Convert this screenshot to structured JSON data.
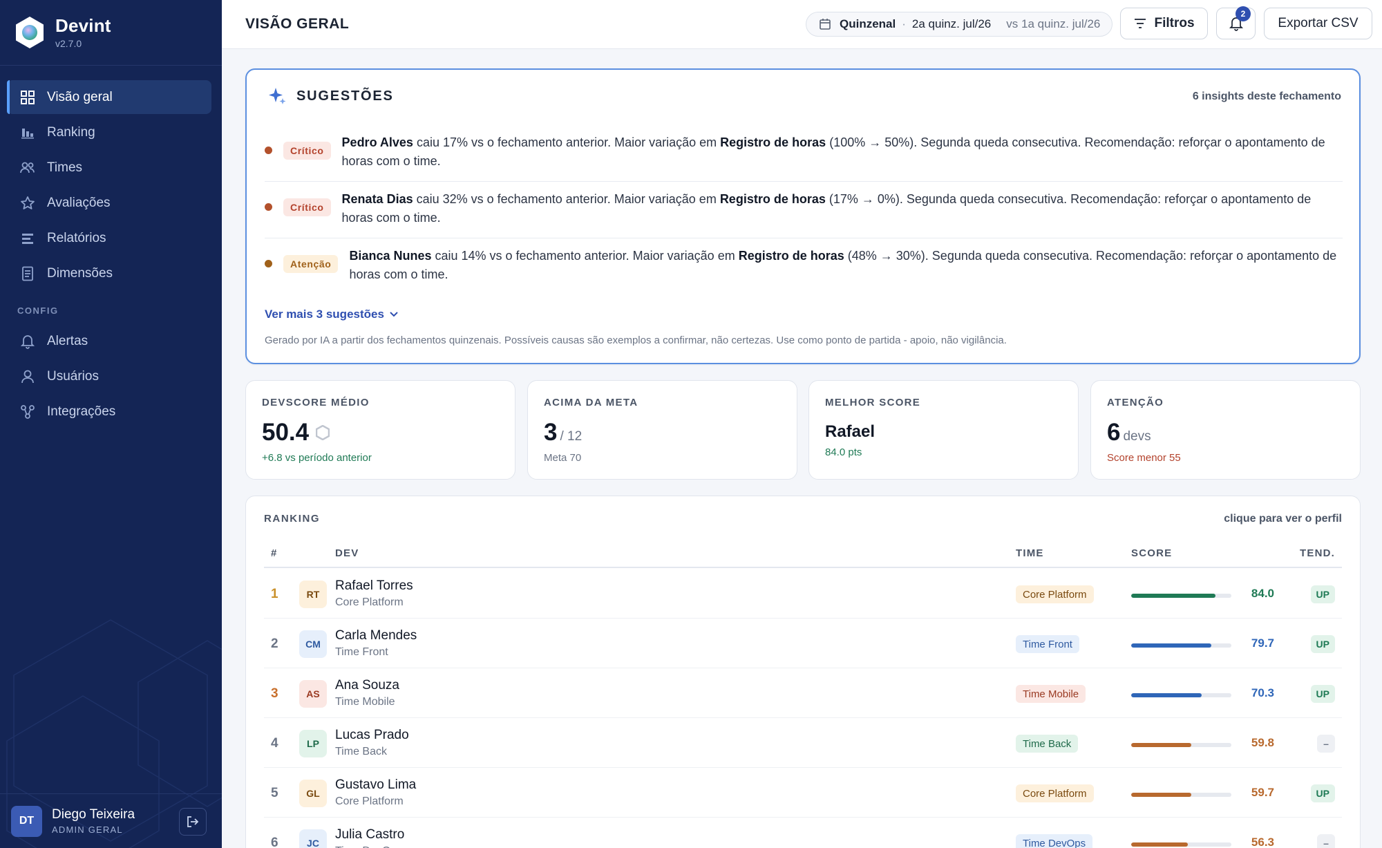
{
  "app": {
    "name": "Devint",
    "version": "v2.7.0"
  },
  "sidebar": {
    "items": [
      {
        "label": "Visão geral",
        "icon": "grid-icon",
        "active": true
      },
      {
        "label": "Ranking",
        "icon": "bar-chart-icon"
      },
      {
        "label": "Times",
        "icon": "users-icon"
      },
      {
        "label": "Avaliações",
        "icon": "star-icon"
      },
      {
        "label": "Relatórios",
        "icon": "list-icon"
      },
      {
        "label": "Dimensões",
        "icon": "document-icon"
      }
    ],
    "config_label": "CONFIG",
    "config_items": [
      {
        "label": "Alertas",
        "icon": "bell-icon"
      },
      {
        "label": "Usuários",
        "icon": "user-icon"
      },
      {
        "label": "Integrações",
        "icon": "integration-icon"
      }
    ]
  },
  "user": {
    "initials": "DT",
    "name": "Diego Teixeira",
    "role": "ADMIN GERAL"
  },
  "header": {
    "title": "VISÃO GERAL",
    "period": {
      "type": "Quinzenal",
      "current": "2a quinz. jul/26",
      "compare": "vs 1a quinz. jul/26"
    },
    "filters_label": "Filtros",
    "notifications_count": "2",
    "export_label": "Exportar CSV"
  },
  "suggestions": {
    "title": "SUGESTÕES",
    "count_label": "6 insights deste fechamento",
    "items": [
      {
        "severity": "Crítico",
        "severity_type": "critico",
        "color": "#b3512c",
        "name": "Pedro Alves",
        "text1": " caiu 17% vs o fechamento anterior. Maior variação em ",
        "dimension": "Registro de horas",
        "text2": " (100% → 50%). Segunda queda consecutiva. Recomendação: reforçar o apontamento de horas com o time."
      },
      {
        "severity": "Crítico",
        "severity_type": "critico",
        "color": "#b3512c",
        "name": "Renata Dias",
        "text1": " caiu 32% vs o fechamento anterior. Maior variação em ",
        "dimension": "Registro de horas",
        "text2": " (17% → 0%). Segunda queda consecutiva. Recomendação: reforçar o apontamento de horas com o time."
      },
      {
        "severity": "Atenção",
        "severity_type": "atencao",
        "color": "#a0611a",
        "name": "Bianca Nunes",
        "text1": " caiu 14% vs o fechamento anterior. Maior variação em ",
        "dimension": "Registro de horas",
        "text2": " (48% → 30%). Segunda queda consecutiva. Recomendação: reforçar o apontamento de horas com o time."
      }
    ],
    "more_label": "Ver mais 3 sugestões",
    "disclaimer": "Gerado por IA a partir dos fechamentos quinzenais. Possíveis causas são exemplos a confirmar, não certezas. Use como ponto de partida - apoio, não vigilância."
  },
  "kpis": {
    "avg": {
      "label": "DEVSCORE MÉDIO",
      "value": "50.4",
      "note": "+6.8 vs período anterior"
    },
    "above": {
      "label": "ACIMA DA META",
      "value": "3",
      "sub": "/ 12",
      "note": "Meta 70"
    },
    "best": {
      "label": "MELHOR SCORE",
      "name": "Rafael",
      "note": "84.0 pts"
    },
    "attention": {
      "label": "ATENÇÃO",
      "value": "6",
      "sub": "devs",
      "note": "Score menor 55"
    }
  },
  "ranking": {
    "title": "RANKING",
    "hint": "clique para ver o perfil",
    "columns": {
      "pos": "#",
      "dev": "DEV",
      "team": "TIME",
      "score": "SCORE",
      "trend": "TEND."
    },
    "rows": [
      {
        "pos": "1",
        "initials": "RT",
        "name": "Rafael Torres",
        "team": "Core Platform",
        "score": 84.0,
        "score_label": "84.0",
        "trend": "UP",
        "trend_type": "up",
        "color": "#1f7a55",
        "chip_bg": "#fdf0dc",
        "chip_fg": "#7a4a10",
        "av_bg": "#fdf0dc",
        "av_fg": "#7a4a10",
        "pos_class": "gold"
      },
      {
        "pos": "2",
        "initials": "CM",
        "name": "Carla Mendes",
        "team": "Time Front",
        "score": 79.7,
        "score_label": "79.7",
        "trend": "UP",
        "trend_type": "up",
        "color": "#2f66b8",
        "chip_bg": "#e6effb",
        "chip_fg": "#2f5aa0",
        "av_bg": "#e6effb",
        "av_fg": "#2f5aa0",
        "pos_class": ""
      },
      {
        "pos": "3",
        "initials": "AS",
        "name": "Ana Souza",
        "team": "Time Mobile",
        "score": 70.3,
        "score_label": "70.3",
        "trend": "UP",
        "trend_type": "up",
        "color": "#2f66b8",
        "chip_bg": "#fbe7e3",
        "chip_fg": "#9a3a22",
        "av_bg": "#fbe7e3",
        "av_fg": "#9a3a22",
        "pos_class": "bronze"
      },
      {
        "pos": "4",
        "initials": "LP",
        "name": "Lucas Prado",
        "team": "Time Back",
        "score": 59.8,
        "score_label": "59.8",
        "trend": "–",
        "trend_type": "flat",
        "color": "#b8692e",
        "chip_bg": "#e2f3ea",
        "chip_fg": "#1f6a4a",
        "av_bg": "#e2f3ea",
        "av_fg": "#1f6a4a",
        "pos_class": ""
      },
      {
        "pos": "5",
        "initials": "GL",
        "name": "Gustavo Lima",
        "team": "Core Platform",
        "score": 59.7,
        "score_label": "59.7",
        "trend": "UP",
        "trend_type": "up",
        "color": "#b8692e",
        "chip_bg": "#fdf0dc",
        "chip_fg": "#7a4a10",
        "av_bg": "#fdf0dc",
        "av_fg": "#7a4a10",
        "pos_class": ""
      },
      {
        "pos": "6",
        "initials": "JC",
        "name": "Julia Castro",
        "team": "Time DevOps",
        "score": 56.3,
        "score_label": "56.3",
        "trend": "–",
        "trend_type": "flat",
        "color": "#b8692e",
        "chip_bg": "#e6effb",
        "chip_fg": "#2f5aa0",
        "av_bg": "#e6effb",
        "av_fg": "#2f5aa0",
        "pos_class": ""
      }
    ]
  }
}
